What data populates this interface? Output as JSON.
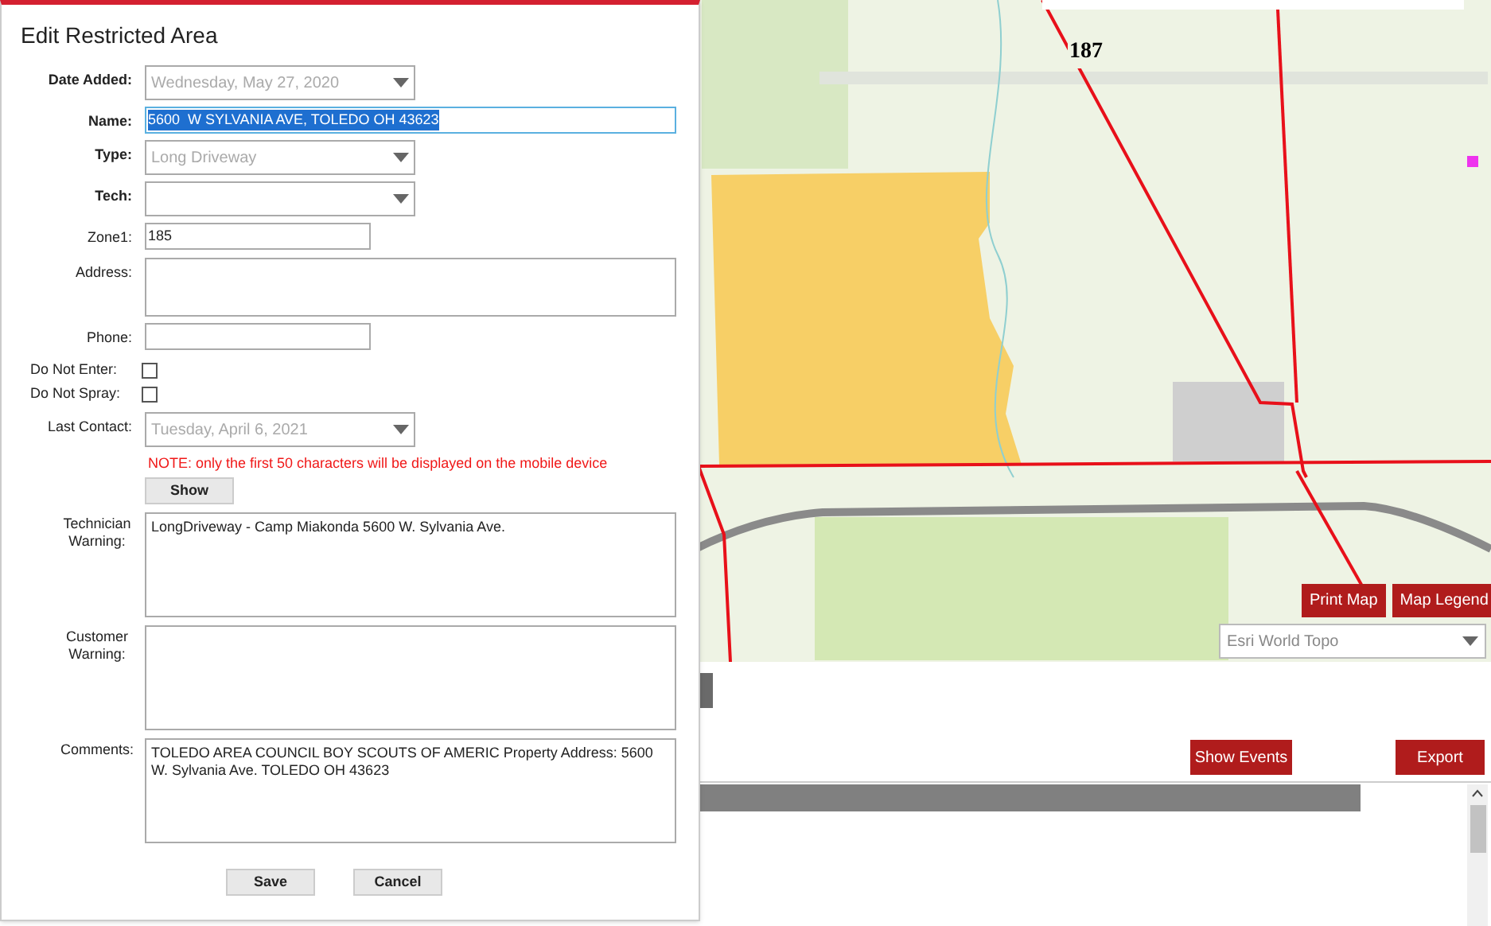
{
  "dialog": {
    "title": "Edit Restricted Area",
    "fields": [
      {
        "kind": "dropdown",
        "label": "Date Added:",
        "bold": true,
        "value": "Wednesday, May 27, 2020",
        "disabled": true
      },
      {
        "kind": "wide_text",
        "label": "Name:",
        "bold": true,
        "value": "5600  W SYLVANIA AVE, TOLEDO OH 43623",
        "highlighted": true
      },
      {
        "kind": "dropdown",
        "label": "Type:",
        "bold": true,
        "value": "Long Driveway",
        "disabled": true
      },
      {
        "kind": "dropdown",
        "label": "Tech:",
        "bold": true
      },
      {
        "kind": "text",
        "label": "Zone1:",
        "bold": false,
        "value": "185"
      },
      {
        "kind": "textarea",
        "label": "Address:",
        "bold": false
      },
      {
        "kind": "text",
        "label": "Phone:",
        "bold": false
      },
      {
        "kind": "checkbox",
        "label": "Do Not Enter:",
        "checked": false
      },
      {
        "kind": "checkbox",
        "label": "Do Not Spray:",
        "checked": false
      },
      {
        "kind": "dropdown",
        "label": "Last Contact:",
        "bold": false,
        "value": "Tuesday, April 6, 2021",
        "disabled": true
      },
      {
        "kind": "note",
        "text": "NOTE: only the first 50 characters will be displayed on the mobile device"
      },
      {
        "kind": "button",
        "label": "Show"
      },
      {
        "kind": "tall_textarea",
        "label": "Technician Warning:",
        "value": "LongDriveway - Camp Miakonda 5600 W. Sylvania Ave."
      },
      {
        "kind": "tall_textarea",
        "label": "Customer Warning:"
      },
      {
        "kind": "tall_textarea",
        "label": "Comments:",
        "value": "TOLEDO AREA COUNCIL BOY SCOUTS OF AMERIC  Property Address: 5600 W. Sylvania Ave. TOLEDO OH 43623"
      }
    ],
    "buttons": [
      "Save",
      "Cancel"
    ]
  },
  "map": {
    "zone_label": "187",
    "buttons": [
      "Print Map",
      "Map Legend"
    ],
    "basemap": "Esri World Topo"
  },
  "actions": [
    "Show Events",
    "Export"
  ]
}
